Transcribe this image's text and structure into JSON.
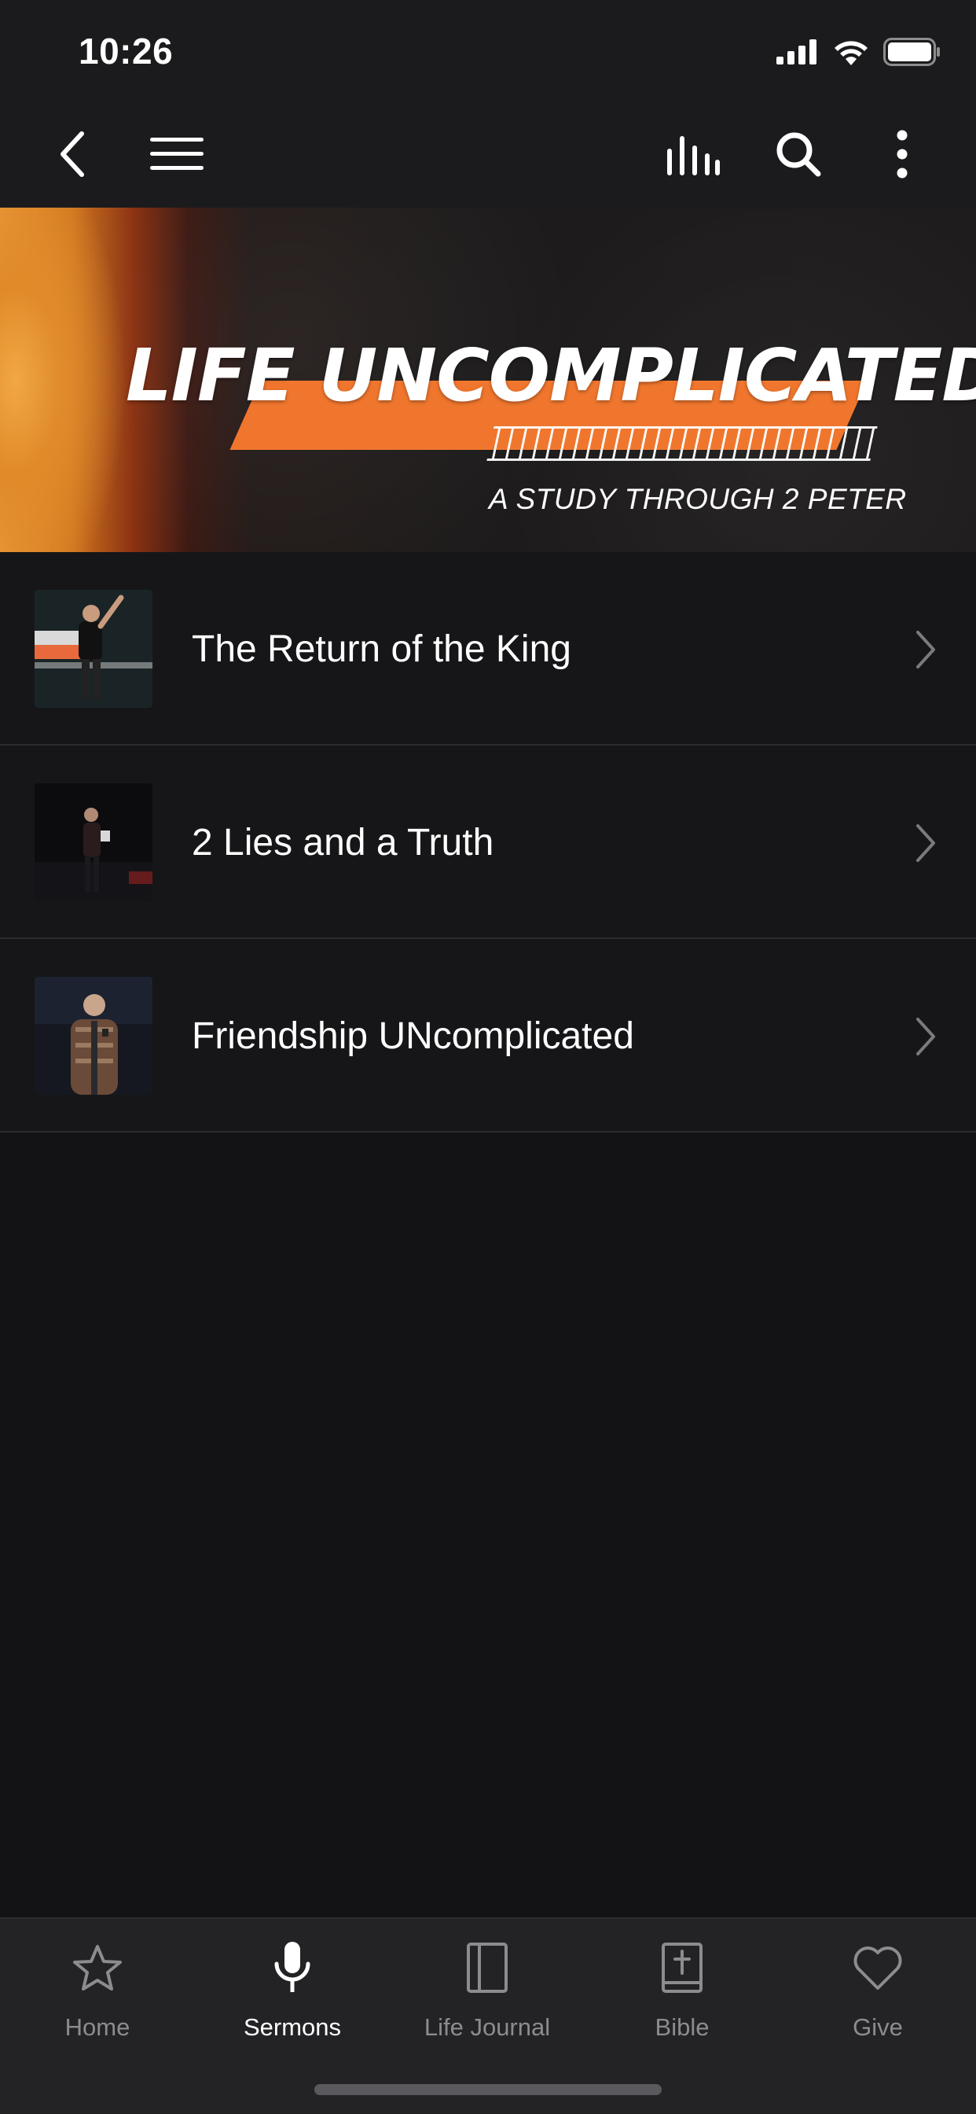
{
  "status_bar": {
    "time": "10:26"
  },
  "top_nav": {
    "icons": [
      "back-icon",
      "menu-icon",
      "audio-bars-icon",
      "search-icon",
      "more-vertical-icon"
    ]
  },
  "banner": {
    "title": "LIFE UNCOMPLICATED",
    "subtitle": "A STUDY THROUGH 2 PETER",
    "accent_color": "#f0762e"
  },
  "sermons": [
    {
      "title": "The Return of the King"
    },
    {
      "title": "2 Lies and a Truth"
    },
    {
      "title": "Friendship UNcomplicated"
    }
  ],
  "tab_bar": {
    "active": "Sermons",
    "tabs": [
      {
        "label": "Home",
        "icon": "star-icon"
      },
      {
        "label": "Sermons",
        "icon": "microphone-icon"
      },
      {
        "label": "Life Journal",
        "icon": "journal-icon"
      },
      {
        "label": "Bible",
        "icon": "bible-icon"
      },
      {
        "label": "Give",
        "icon": "heart-icon"
      }
    ]
  },
  "colors": {
    "background": "#131316",
    "nav_background": "#1b1b1d",
    "tab_bar_background": "#232325",
    "inactive_tab": "#8c8c90",
    "active_tab": "#ffffff"
  }
}
